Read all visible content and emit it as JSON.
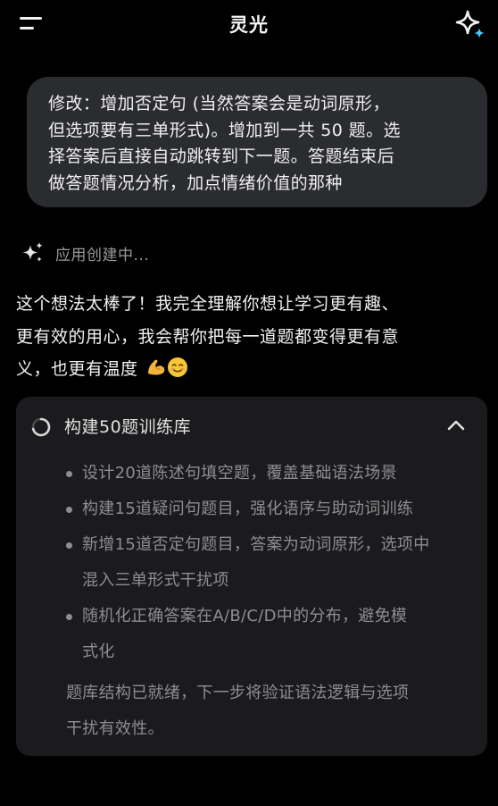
{
  "app": {
    "title": "灵光"
  },
  "colors": {
    "background": "#000000",
    "bubble": "#2b2c30",
    "card": "#1b1b1d",
    "muted_text": "#8e8e90",
    "accent_sparkle": "#4fc3f7"
  },
  "icons": {
    "menu": "menu-icon",
    "new_chat": "sparkle-icon",
    "status": "sparkles-icon",
    "task_spinner": "loading-spinner-icon",
    "collapse": "chevron-up-icon"
  },
  "user_message": {
    "lines": [
      "修改：增加否定句 (当然答案会是动词原形，",
      "但选项要有三单形式)。增加到一共 50 题。选",
      "择答案后直接自动跳转到下一题。答题结束后",
      "做答题情况分析，加点情绪价值的那种"
    ]
  },
  "status": {
    "text": "应用创建中..."
  },
  "reply": {
    "lines": [
      "这个想法太棒了！我完全理解你想让学习更有趣、",
      "更有效的用心，我会帮你把每一道题都变得更有意",
      "义，也更有温度"
    ],
    "emojis": [
      "💪",
      "😊"
    ]
  },
  "task": {
    "title": "构建50题训练库",
    "bullets": [
      {
        "lines": [
          "设计20道陈述句填空题，覆盖基础语法场景"
        ]
      },
      {
        "lines": [
          "构建15道疑问句题目，强化语序与助动词训练"
        ]
      },
      {
        "lines": [
          "新增15道否定句题目，答案为动词原形，选项中",
          "混入三单形式干扰项"
        ]
      },
      {
        "lines": [
          "随机化正确答案在A/B/C/D中的分布，避免模",
          "式化"
        ]
      }
    ],
    "summary_lines": [
      "题库结构已就绪，下一步将验证语法逻辑与选项",
      "干扰有效性。"
    ]
  }
}
